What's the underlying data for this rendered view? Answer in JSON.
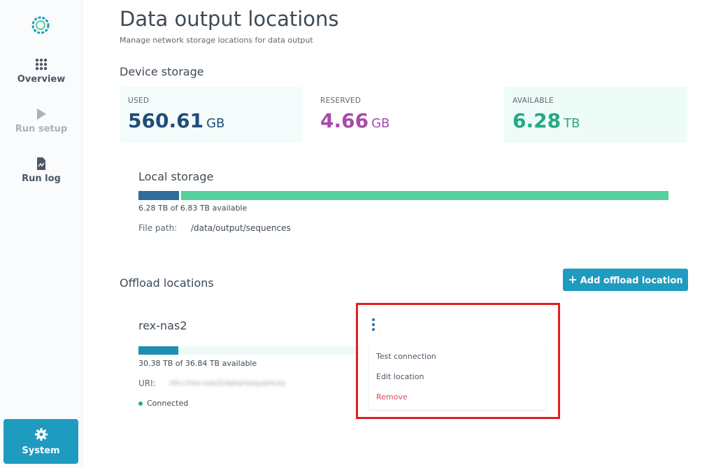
{
  "sidebar": {
    "items": [
      {
        "label": "Overview",
        "icon": "grid-icon"
      },
      {
        "label": "Run setup",
        "icon": "play-icon"
      },
      {
        "label": "Run log",
        "icon": "document-icon"
      }
    ],
    "system": {
      "label": "System",
      "icon": "gear-icon"
    }
  },
  "header": {
    "title": "Data output locations",
    "subtitle": "Manage network storage locations for data output"
  },
  "device_storage": {
    "title": "Device storage",
    "used": {
      "label": "USED",
      "value": "560.61",
      "unit": "GB"
    },
    "reserved": {
      "label": "RESERVED",
      "value": "4.66",
      "unit": "GB"
    },
    "available": {
      "label": "AVAILABLE",
      "value": "6.28",
      "unit": "TB"
    }
  },
  "local_storage": {
    "title": "Local storage",
    "used_fraction": 0.08,
    "available_text": "6.28 TB of 6.83 TB available",
    "file_path_label": "File path:",
    "file_path": "/data/output/sequences"
  },
  "offload": {
    "title": "Offload locations",
    "add_button": "Add offload location",
    "locations": [
      {
        "name": "rex-nas2",
        "used_fraction": 0.18,
        "available_text": "30.38 TB of 36.84 TB available",
        "uri_label": "URI:",
        "uri_value": "nfs://rex-nas2/data/sequences",
        "status": "Connected"
      }
    ],
    "menu": {
      "test": "Test connection",
      "edit": "Edit location",
      "remove": "Remove"
    }
  },
  "colors": {
    "accent": "#1f9bbf",
    "used": "#1f4d7a",
    "reserved": "#a84ba8",
    "available": "#25a882",
    "danger": "#e0475b",
    "highlight": "#e02020"
  }
}
